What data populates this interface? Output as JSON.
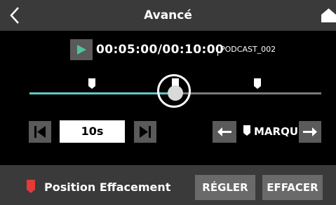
{
  "header": {
    "title": "Avancé",
    "back_icon": "chevron-left-icon",
    "home_icon": "home-icon"
  },
  "transport": {
    "play_icon": "play-icon",
    "time_display": "00:05:00/00:10:00",
    "project_name": "PODCAST_002"
  },
  "timeline": {
    "progress": 0.5,
    "markers": 3,
    "played_color": "#5fc9c6",
    "remaining_color": "#7a7a7a"
  },
  "controls": {
    "skip_prev_icon": "skip-to-start-icon",
    "skip_value": "10s",
    "skip_next_icon": "skip-to-end-icon",
    "mark_prev_icon": "arrow-left-icon",
    "mark_icon": "marker-flag-icon",
    "mark_label": "MARQU",
    "mark_next_icon": "arrow-right-icon"
  },
  "footer": {
    "erase_icon": "erase-position-flag-icon",
    "erase_flag_color": "#e53a3a",
    "erase_label": "Position Effacement",
    "set_label": "RÉGLER",
    "clear_label": "EFFACER"
  }
}
